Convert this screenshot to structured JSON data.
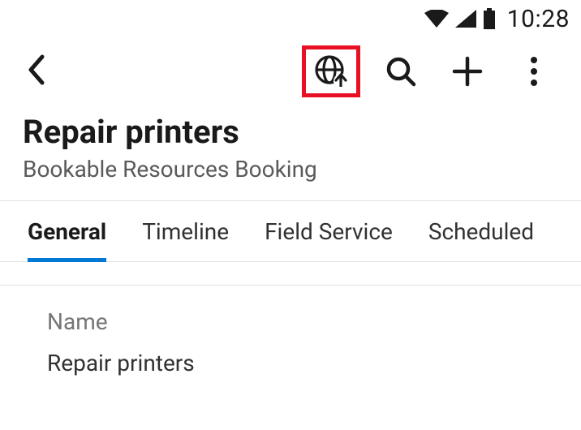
{
  "status_bar": {
    "time": "10:28"
  },
  "header": {
    "title": "Repair printers",
    "subtitle": "Bookable Resources Booking"
  },
  "tabs": [
    {
      "label": "General",
      "active": true
    },
    {
      "label": "Timeline",
      "active": false
    },
    {
      "label": "Field Service",
      "active": false
    },
    {
      "label": "Scheduled",
      "active": false
    }
  ],
  "form": {
    "name_label": "Name",
    "name_value": "Repair printers"
  },
  "icons": {
    "back": "back-icon",
    "globe_upload": "globe-upload-icon",
    "search": "search-icon",
    "add": "add-icon",
    "more": "more-vertical-icon",
    "wifi": "wifi-icon",
    "cell": "cell-signal-icon",
    "battery": "battery-icon"
  },
  "colors": {
    "accent": "#0078d4",
    "highlight": "#e81123"
  }
}
